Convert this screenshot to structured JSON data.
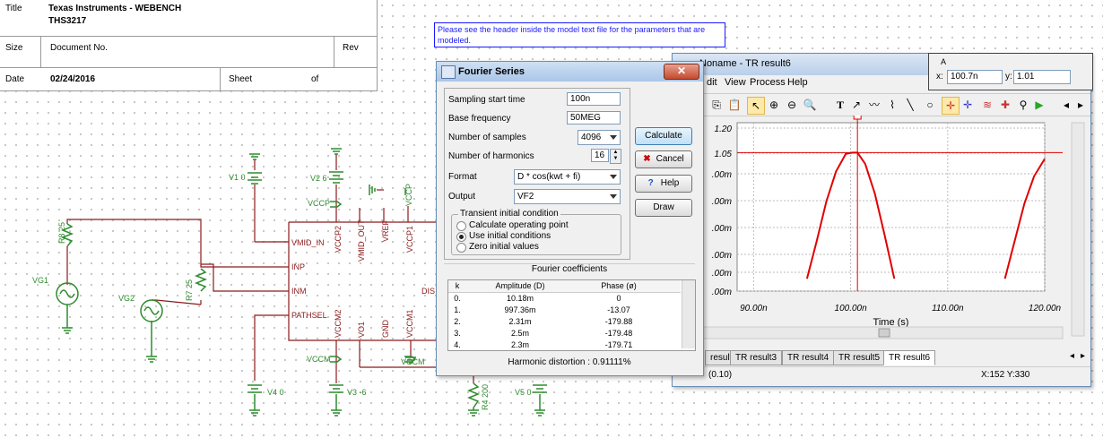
{
  "title_block": {
    "title_label": "Title",
    "title_line1": "Texas Instruments - WEBENCH",
    "title_line2": "THS3217",
    "size_label": "Size",
    "doc_label": "Document No.",
    "rev_label": "Rev",
    "date_label": "Date",
    "date_value": "02/24/2016",
    "sheet_label": "Sheet",
    "of_label": "of"
  },
  "note": "Please see the header inside  the model text file for the parameters that are modeled.",
  "schematic": {
    "v1": "V1 0",
    "v2": "V2 6",
    "v3": "V3 -6",
    "v4": "V4 0",
    "v5": "V5 0",
    "vccp": "VCCP",
    "vccm_a": "VCCM",
    "vccm_b": "VCCM",
    "vg1": "VG1",
    "vg2": "VG2",
    "r8": "R8 25",
    "r7": "R7 25",
    "r4": "R4 200",
    "pins": [
      "VMID_IN",
      "INP",
      "INM",
      "PATHSEL",
      "VCCP2",
      "VMID_OUT",
      "VREF",
      "VCCP1",
      "VCCM2",
      "VO1",
      "GND",
      "VCCM1"
    ],
    "vccp_rot": "VCCP",
    "dis": "DIS"
  },
  "fourier": {
    "title": "Fourier Series",
    "close": "✕",
    "sampling_start_label": "Sampling start time",
    "sampling_start_value": "100n",
    "base_freq_label": "Base frequency",
    "base_freq_value": "50MEG",
    "samples_label": "Number of samples",
    "samples_value": "4096",
    "harmonics_label": "Number of harmonics",
    "harmonics_value": "16",
    "format_label": "Format",
    "format_value": "D * cos(kwt + fi)",
    "output_label": "Output",
    "output_value": "VF2",
    "transient_group": "Transient initial condition",
    "options": [
      "Calculate operating point",
      "Use initial conditions",
      "Zero initial values"
    ],
    "selected_option": 1,
    "buttons": {
      "calculate": "Calculate",
      "cancel": "Cancel",
      "help": "Help",
      "draw": "Draw"
    },
    "coef_title": "Fourier coefficients",
    "coef_headers": [
      "k",
      "Amplitude (D)",
      "Phase (ø)"
    ],
    "coef_rows": [
      [
        "0.",
        "10.18m",
        "0"
      ],
      [
        "1.",
        "997.36m",
        "-13.07"
      ],
      [
        "2.",
        "2.31m",
        "-179.88"
      ],
      [
        "3.",
        "2.5m",
        "-179.48"
      ],
      [
        "4.",
        "2.3m",
        "-179.71"
      ]
    ],
    "distortion": "Harmonic distortion :  0.91111%"
  },
  "result_window": {
    "title": "Noname - TR result6",
    "menu": [
      "dit",
      "View",
      "Process",
      "Help"
    ],
    "tabs": [
      "result2",
      "TR result3",
      "TR result4",
      "TR result5",
      "TR result6"
    ],
    "active_tab": 4,
    "status_left": "(0.10)",
    "status_right": "X:152  Y:330"
  },
  "coord_box": {
    "label": "A",
    "x_label": "x:",
    "x_value": "100.7n",
    "y_label": "y:",
    "y_value": "1.01"
  },
  "chart_data": {
    "type": "line",
    "xlabel": "Time (s)",
    "x_ticks": [
      "90.00n",
      "100.00n",
      "110.00n",
      "120.00n"
    ],
    "y_ticks": [
      "1.20",
      "1.05",
      ".00m",
      ".00m",
      ".00m",
      ".00m",
      ".00m",
      ".00m"
    ],
    "x_range": [
      88.3,
      120.0
    ],
    "series": [
      {
        "name": "",
        "color": "#e00000",
        "x": [
          95.5,
          96.5,
          97.5,
          98.5,
          99.5,
          100.2,
          100.7,
          101.5,
          102.5,
          103.5,
          104.5
        ],
        "y": [
          0.0,
          0.3,
          0.62,
          0.86,
          1.0,
          1.01,
          1.01,
          0.92,
          0.68,
          0.35,
          0.0
        ]
      },
      {
        "name": "",
        "color": "#e00000",
        "x": [
          115.9,
          116.9,
          117.9,
          118.9,
          120.0
        ],
        "y": [
          0.0,
          0.3,
          0.6,
          0.82,
          0.96
        ]
      }
    ],
    "cursor": {
      "x": 100.7,
      "y": 1.01
    },
    "grid": true
  },
  "colors": {
    "wire": "#8b1a1a",
    "label": "#3a8a3a",
    "pin": "#8b1a1a",
    "trace": "#e00000",
    "green": "#2e8b2e"
  }
}
